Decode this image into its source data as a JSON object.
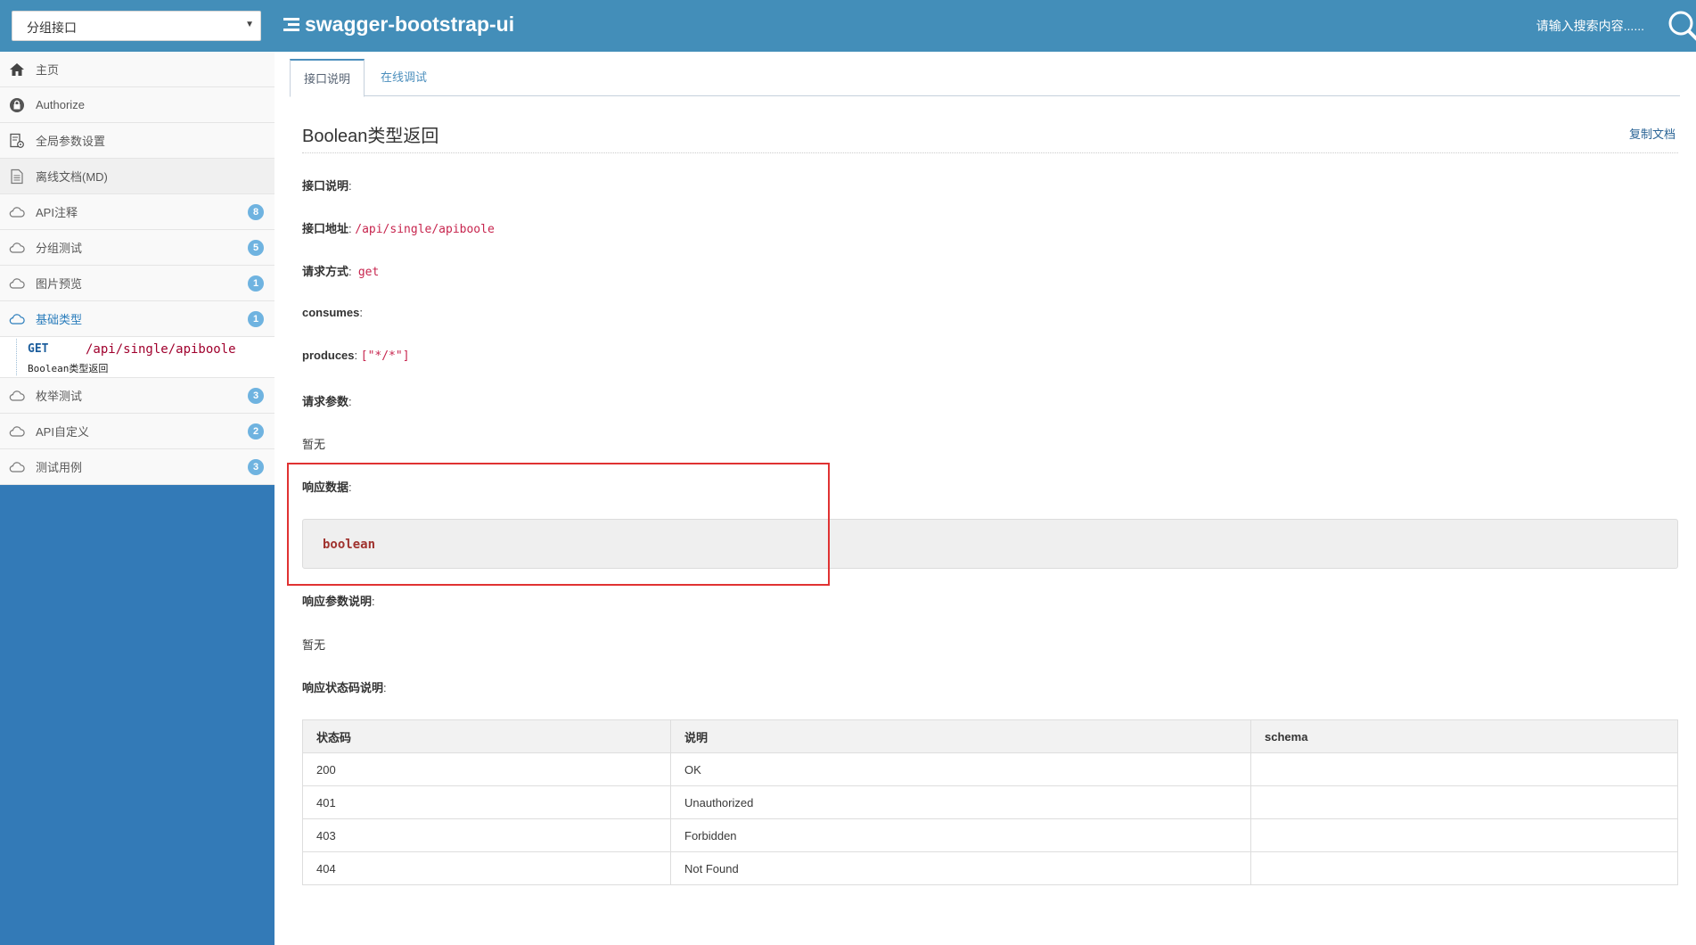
{
  "navbar": {
    "group_select": "分组接口",
    "brand": "swagger-bootstrap-ui",
    "search_placeholder": "请输入搜索内容......"
  },
  "sidebar": {
    "items": [
      {
        "label": "主页",
        "icon": "home-icon"
      },
      {
        "label": "Authorize",
        "icon": "lock-icon"
      },
      {
        "label": "全局参数设置",
        "icon": "settings-doc-icon"
      },
      {
        "label": "离线文档(MD)",
        "icon": "document-icon"
      },
      {
        "label": "API注释",
        "icon": "cloud-icon",
        "badge": "8"
      },
      {
        "label": "分组测试",
        "icon": "cloud-icon",
        "badge": "5"
      },
      {
        "label": "图片预览",
        "icon": "cloud-icon",
        "badge": "1"
      },
      {
        "label": "基础类型",
        "icon": "cloud-icon",
        "badge": "1"
      },
      {
        "label": "枚举测试",
        "icon": "cloud-icon",
        "badge": "3"
      },
      {
        "label": "API自定义",
        "icon": "cloud-icon",
        "badge": "2"
      },
      {
        "label": "测试用例",
        "icon": "cloud-icon",
        "badge": "3"
      }
    ],
    "sub_item": {
      "method": "GET",
      "path": "/api/single/apiboole",
      "summary": "Boolean类型返回"
    }
  },
  "main": {
    "tabs": [
      "接口说明",
      "在线调试"
    ],
    "title": "Boolean类型返回",
    "copy_label": "复制文档",
    "fields": {
      "desc_label": "接口说明",
      "url_label": "接口地址",
      "url_value": "/api/single/apiboole",
      "method_label": "请求方式",
      "method_value": "get",
      "consumes_label": "consumes",
      "produces_label": "produces",
      "produces_value": "[\"*/*\"]",
      "params_label": "请求参数",
      "params_value": "暂无",
      "response_label": "响应数据",
      "response_value": "boolean",
      "resp_params_label": "响应参数说明",
      "resp_params_value": "暂无",
      "status_label": "响应状态码说明"
    },
    "status_table": {
      "headers": [
        "状态码",
        "说明",
        "schema"
      ],
      "rows": [
        [
          "200",
          "OK",
          ""
        ],
        [
          "401",
          "Unauthorized",
          ""
        ],
        [
          "403",
          "Forbidden",
          ""
        ],
        [
          "404",
          "Not Found",
          ""
        ]
      ]
    }
  },
  "colors": {
    "navbar": "#438eb9",
    "sidebar": "#337ab7",
    "badge": "#6fb3e0",
    "link": "#4c8fbd",
    "code": "#c7254e",
    "highlight": "#e03232"
  }
}
